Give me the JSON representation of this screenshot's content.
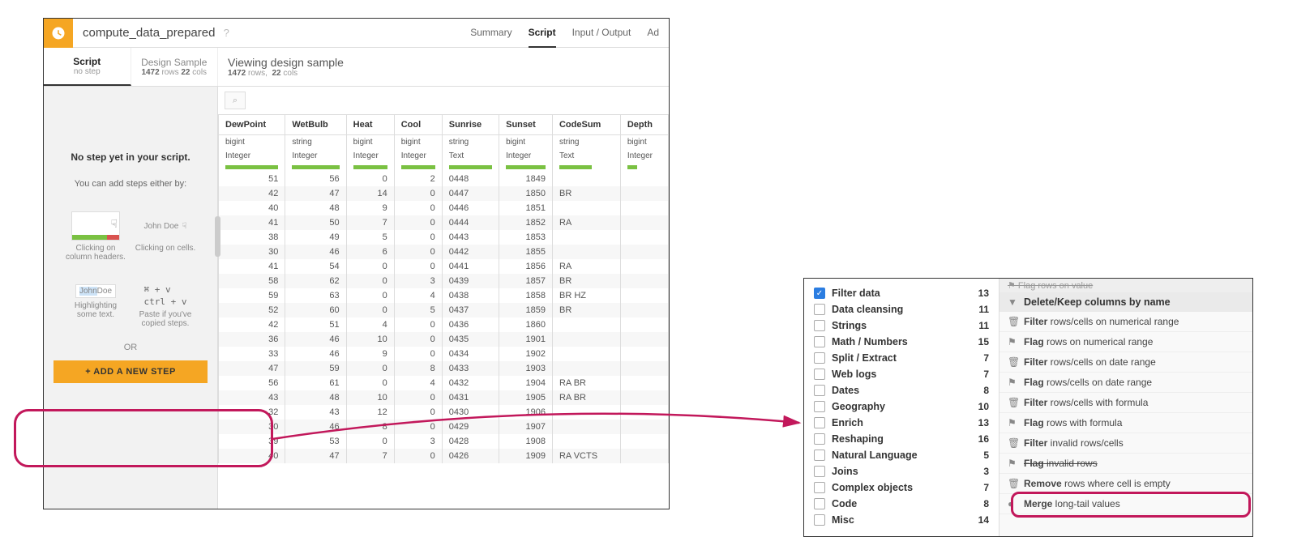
{
  "header": {
    "dataset_name": "compute_data_prepared",
    "nav": [
      "Summary",
      "Script",
      "Input / Output",
      "Ad"
    ],
    "active_nav": "Script"
  },
  "subheader": {
    "script_tab": "Script",
    "script_sub": "no step",
    "sample_tab": "Design Sample",
    "sample_rows": "1472",
    "sample_cols": "22",
    "viewing_title": "Viewing design sample",
    "viewing_rows": "1472",
    "viewing_cols": "22"
  },
  "sidebar": {
    "nostep": "No step yet in your script.",
    "addsteps": "You can add steps either by:",
    "hint_headers": "Clicking on column headers.",
    "hint_cells": "Clicking on cells.",
    "hint_highlight": "Highlighting some text.",
    "hint_paste": "Paste if you've copied steps.",
    "kbd1": "⌘ + v",
    "kbd2": "ctrl + v",
    "johndoe": "John Doe",
    "johndoe_hl": "JohnDoe",
    "or": "OR",
    "add_button": "+ ADD A NEW STEP"
  },
  "table": {
    "columns": [
      {
        "name": "DewPoint",
        "type": "bigint",
        "sub": "Integer"
      },
      {
        "name": "WetBulb",
        "type": "string",
        "sub": "Integer"
      },
      {
        "name": "Heat",
        "type": "bigint",
        "sub": "Integer"
      },
      {
        "name": "Cool",
        "type": "bigint",
        "sub": "Integer"
      },
      {
        "name": "Sunrise",
        "type": "string",
        "sub": "Text"
      },
      {
        "name": "Sunset",
        "type": "bigint",
        "sub": "Integer"
      },
      {
        "name": "CodeSum",
        "type": "string",
        "sub": "Text"
      },
      {
        "name": "Depth",
        "type": "bigint",
        "sub": "Integer"
      }
    ],
    "rows": [
      [
        "51",
        "56",
        "0",
        "2",
        "0448",
        "1849",
        "",
        ""
      ],
      [
        "42",
        "47",
        "14",
        "0",
        "0447",
        "1850",
        "BR",
        ""
      ],
      [
        "40",
        "48",
        "9",
        "0",
        "0446",
        "1851",
        "",
        ""
      ],
      [
        "41",
        "50",
        "7",
        "0",
        "0444",
        "1852",
        "RA",
        ""
      ],
      [
        "38",
        "49",
        "5",
        "0",
        "0443",
        "1853",
        "",
        ""
      ],
      [
        "30",
        "46",
        "6",
        "0",
        "0442",
        "1855",
        "",
        ""
      ],
      [
        "41",
        "54",
        "0",
        "0",
        "0441",
        "1856",
        "RA",
        ""
      ],
      [
        "58",
        "62",
        "0",
        "3",
        "0439",
        "1857",
        "BR",
        ""
      ],
      [
        "59",
        "63",
        "0",
        "4",
        "0438",
        "1858",
        "BR HZ",
        ""
      ],
      [
        "52",
        "60",
        "0",
        "5",
        "0437",
        "1859",
        "BR",
        ""
      ],
      [
        "42",
        "51",
        "4",
        "0",
        "0436",
        "1860",
        "",
        ""
      ],
      [
        "36",
        "46",
        "10",
        "0",
        "0435",
        "1901",
        "",
        ""
      ],
      [
        "33",
        "46",
        "9",
        "0",
        "0434",
        "1902",
        "",
        ""
      ],
      [
        "47",
        "59",
        "0",
        "8",
        "0433",
        "1903",
        "",
        ""
      ],
      [
        "56",
        "61",
        "0",
        "4",
        "0432",
        "1904",
        "RA BR",
        ""
      ],
      [
        "43",
        "48",
        "10",
        "0",
        "0431",
        "1905",
        "RA BR",
        ""
      ],
      [
        "32",
        "43",
        "12",
        "0",
        "0430",
        "1906",
        "",
        ""
      ],
      [
        "30",
        "46",
        "8",
        "0",
        "0429",
        "1907",
        "",
        ""
      ],
      [
        "39",
        "53",
        "0",
        "3",
        "0428",
        "1908",
        "",
        ""
      ],
      [
        "40",
        "47",
        "7",
        "0",
        "0426",
        "1909",
        "RA VCTS",
        ""
      ]
    ]
  },
  "categories": [
    {
      "label": "Filter data",
      "count": 13,
      "checked": true
    },
    {
      "label": "Data cleansing",
      "count": 11
    },
    {
      "label": "Strings",
      "count": 11
    },
    {
      "label": "Math / Numbers",
      "count": 15
    },
    {
      "label": "Split / Extract",
      "count": 7
    },
    {
      "label": "Web logs",
      "count": 7
    },
    {
      "label": "Dates",
      "count": 8
    },
    {
      "label": "Geography",
      "count": 10
    },
    {
      "label": "Enrich",
      "count": 13
    },
    {
      "label": "Reshaping",
      "count": 16
    },
    {
      "label": "Natural Language",
      "count": 5
    },
    {
      "label": "Joins",
      "count": 3
    },
    {
      "label": "Complex objects",
      "count": 7
    },
    {
      "label": "Code",
      "count": 8
    },
    {
      "label": "Misc",
      "count": 14
    }
  ],
  "processors": {
    "top_cut": "Flag rows on value",
    "group_header": {
      "icon": "funnel",
      "bold": "Delete/Keep",
      "rest": " columns by name"
    },
    "items": [
      {
        "icon": "trash",
        "bold": "Filter",
        "rest": " rows/cells on numerical range"
      },
      {
        "icon": "flag",
        "bold": "Flag",
        "rest": " rows on numerical range"
      },
      {
        "icon": "trash",
        "bold": "Filter",
        "rest": " rows/cells on date range"
      },
      {
        "icon": "flag",
        "bold": "Flag",
        "rest": " rows/cells on date range"
      },
      {
        "icon": "trash",
        "bold": "Filter",
        "rest": " rows/cells with formula"
      },
      {
        "icon": "flag",
        "bold": "Flag",
        "rest": " rows with formula"
      },
      {
        "icon": "trash",
        "bold": "Filter",
        "rest": " invalid rows/cells"
      },
      {
        "icon": "flag",
        "bold": "Flag",
        "rest": " invalid rows",
        "strike": true
      },
      {
        "icon": "trash",
        "bold": "Remove",
        "rest": " rows where cell is empty"
      },
      {
        "icon": "merge",
        "bold": "Merge",
        "rest": " long-tail values"
      }
    ]
  }
}
